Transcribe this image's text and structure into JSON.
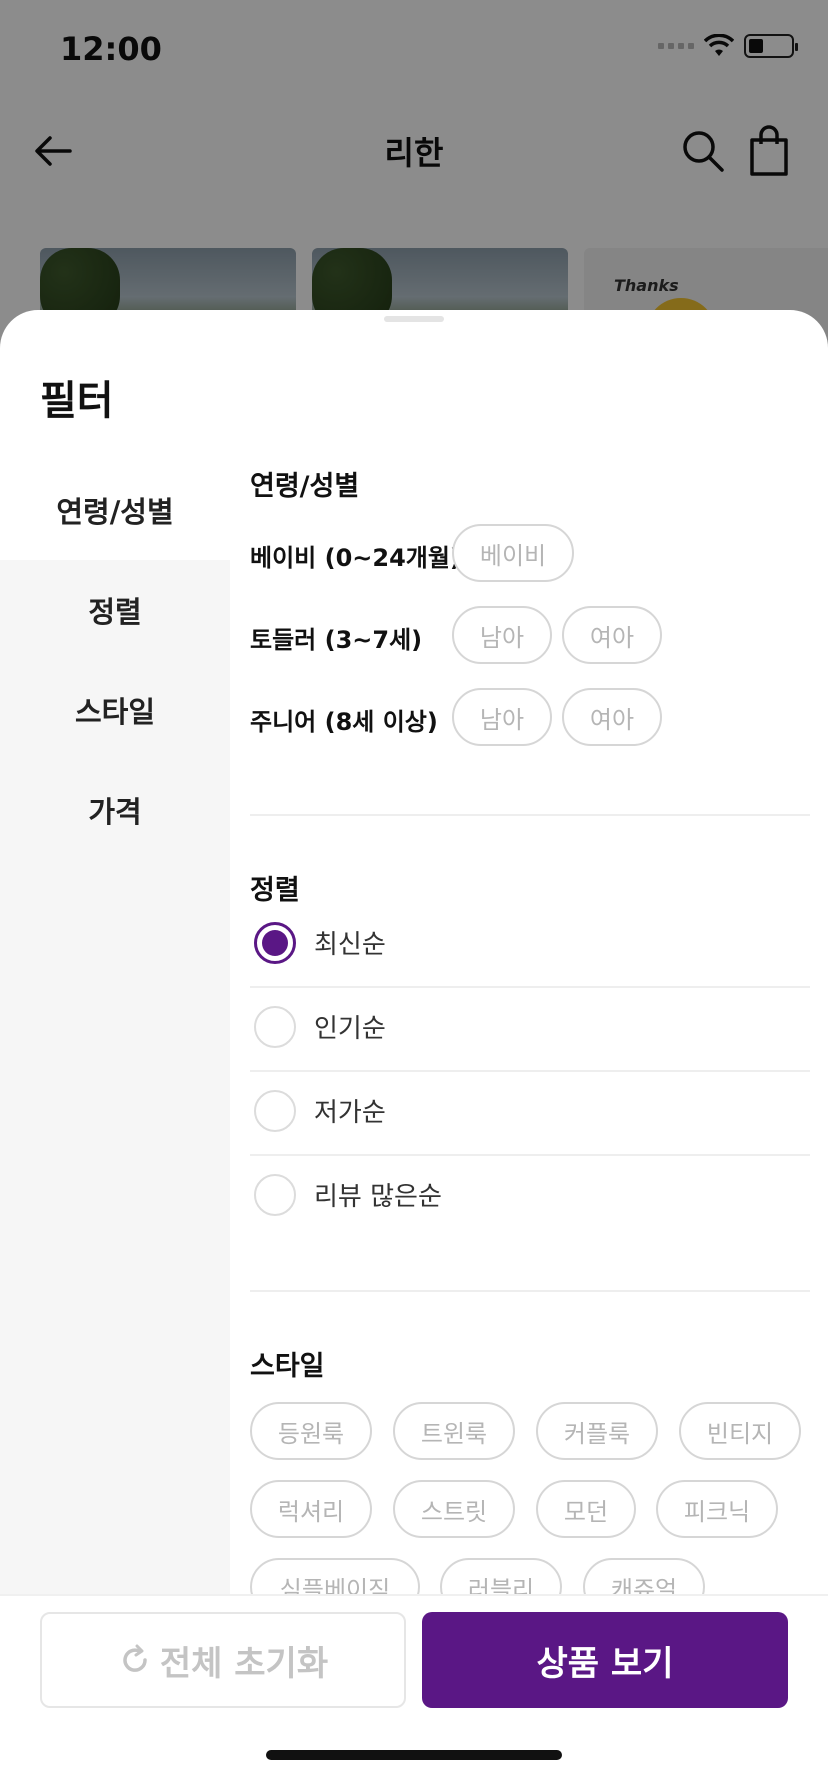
{
  "status_bar": {
    "time": "12:00"
  },
  "header": {
    "title": "리한",
    "back_icon": "arrow-left-icon",
    "search_icon": "search-icon",
    "cart_icon": "shopping-bag-icon"
  },
  "thumbnails": [
    {
      "kind": "photo"
    },
    {
      "kind": "photo"
    },
    {
      "kind": "shirt",
      "text": "Thanks"
    }
  ],
  "filter": {
    "title": "필터",
    "nav": [
      {
        "label": "연령/성별",
        "active": true
      },
      {
        "label": "정렬",
        "active": false
      },
      {
        "label": "스타일",
        "active": false
      },
      {
        "label": "가격",
        "active": false
      }
    ],
    "age_section": {
      "title": "연령/성별",
      "rows": [
        {
          "label": "베이비 (0~24개월)",
          "chips": [
            "베이비"
          ]
        },
        {
          "label": "토들러 (3~7세)",
          "chips": [
            "남아",
            "여아"
          ]
        },
        {
          "label": "주니어 (8세 이상)",
          "chips": [
            "남아",
            "여아"
          ]
        }
      ]
    },
    "sort_section": {
      "title": "정렬",
      "options": [
        {
          "label": "최신순",
          "selected": true
        },
        {
          "label": "인기순",
          "selected": false
        },
        {
          "label": "저가순",
          "selected": false
        },
        {
          "label": "리뷰 많은순",
          "selected": false
        }
      ]
    },
    "style_section": {
      "title": "스타일",
      "chips": [
        "등원룩",
        "트윈룩",
        "커플룩",
        "빈티지",
        "럭셔리",
        "스트릿",
        "모던",
        "피크닉",
        "심플베이직",
        "러블리",
        "캐쥬얼"
      ]
    }
  },
  "actions": {
    "reset_label": "전체 초기화",
    "view_label": "상품 보기"
  },
  "colors": {
    "accent": "#5a1785",
    "chip_border": "#d6d6d6",
    "chip_text": "#b5b5b5"
  }
}
